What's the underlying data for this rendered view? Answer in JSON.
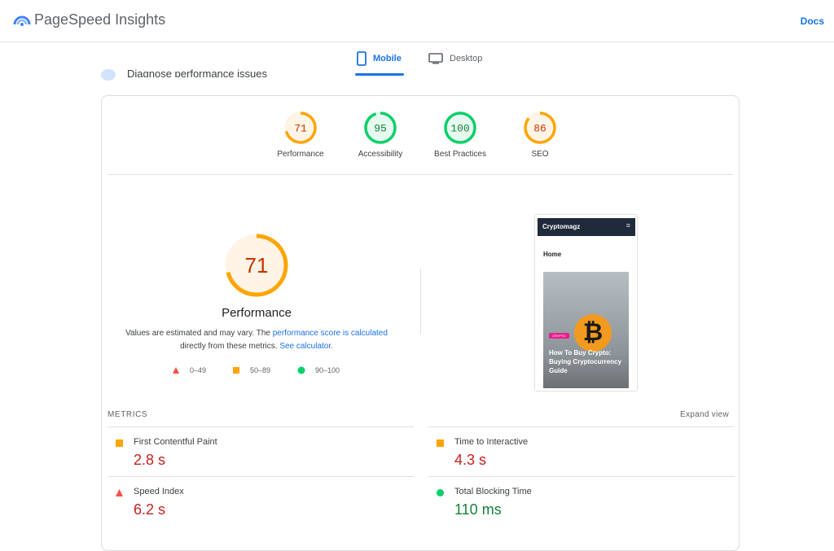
{
  "header": {
    "app_title": "PageSpeed Insights",
    "docs_link": "Docs"
  },
  "tabs": [
    {
      "label": "Mobile",
      "icon": "phone-icon",
      "active": true
    },
    {
      "label": "Desktop",
      "icon": "monitor-icon",
      "active": false
    }
  ],
  "diagnose_heading": "Diagnose performance issues",
  "gauges": [
    {
      "score": "71",
      "label": "Performance",
      "status": "average",
      "color": "#ffa400",
      "fraction": 0.71
    },
    {
      "score": "95",
      "label": "Accessibility",
      "status": "pass",
      "color": "#0cce6b",
      "fraction": 0.95
    },
    {
      "score": "100",
      "label": "Best Practices",
      "status": "pass",
      "color": "#0cce6b",
      "fraction": 1.0
    },
    {
      "score": "86",
      "label": "SEO",
      "status": "average",
      "color": "#ffa400",
      "fraction": 0.86
    }
  ],
  "performance": {
    "score": "71",
    "label": "Performance",
    "desc_text_1": "Values are estimated and may vary. The ",
    "desc_link_1": "performance score is calculated",
    "desc_text_2": " directly from these metrics. ",
    "desc_link_2": "See calculator."
  },
  "legend": [
    {
      "range": "0–49",
      "shape": "triangle",
      "color": "#ff4e42"
    },
    {
      "range": "50–89",
      "shape": "square",
      "color": "#ffa400"
    },
    {
      "range": "90–100",
      "shape": "circle",
      "color": "#0cce6b"
    }
  ],
  "screenshot": {
    "site_name": "Cryptomagz",
    "nav_heading": "Home",
    "badge": "CRYPTO",
    "caption": "How To Buy Crypto: Buying Cryptocurrency Guide",
    "coin_symbol": "₿"
  },
  "metrics": {
    "heading": "METRICS",
    "expand_label": "Expand view",
    "items": [
      {
        "name": "First Contentful Paint",
        "value": "2.8 s",
        "status": "average"
      },
      {
        "name": "Time to Interactive",
        "value": "4.3 s",
        "status": "average"
      },
      {
        "name": "Speed Index",
        "value": "6.2 s",
        "status": "fail"
      },
      {
        "name": "Total Blocking Time",
        "value": "110 ms",
        "status": "pass"
      }
    ]
  },
  "colors": {
    "accent": "#1a73e8",
    "fail": "#c5221f",
    "average_text": "#c5221f",
    "pass_text": "#188038"
  }
}
